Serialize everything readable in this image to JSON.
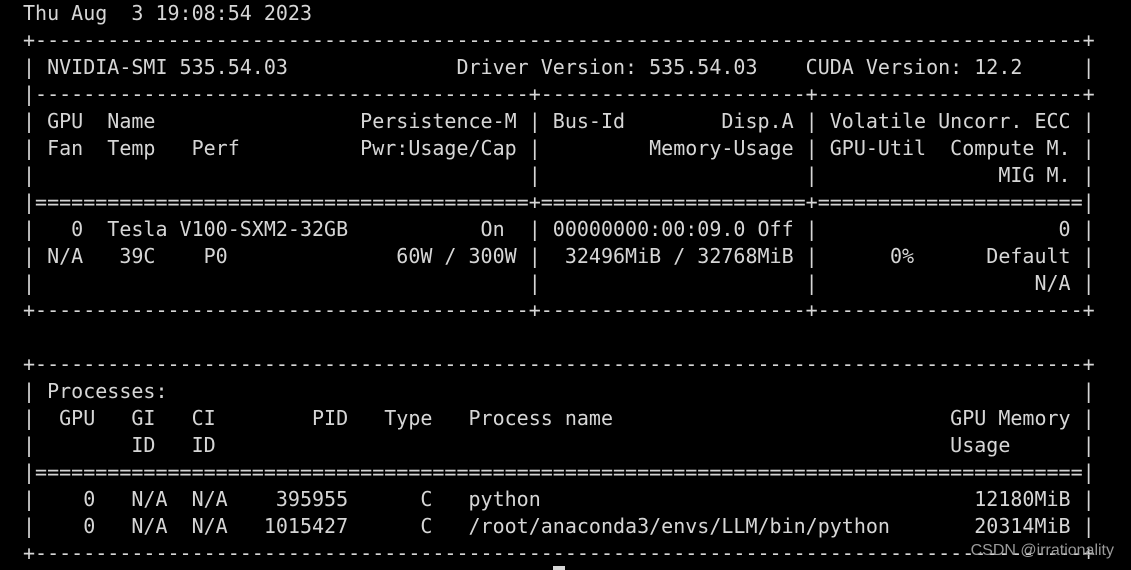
{
  "terminal": {
    "lines": [
      "Thu Aug  3 19:08:54 2023",
      "+---------------------------------------------------------------------------------------+",
      "| NVIDIA-SMI 535.54.03              Driver Version: 535.54.03    CUDA Version: 12.2     |",
      "|-----------------------------------------+----------------------+----------------------+",
      "| GPU  Name                 Persistence-M | Bus-Id        Disp.A | Volatile Uncorr. ECC |",
      "| Fan  Temp   Perf          Pwr:Usage/Cap |         Memory-Usage | GPU-Util  Compute M. |",
      "|                                         |                      |               MIG M. |",
      "|=========================================+======================+======================|",
      "|   0  Tesla V100-SXM2-32GB           On  | 00000000:00:09.0 Off |                    0 |",
      "| N/A   39C    P0              60W / 300W |  32496MiB / 32768MiB |      0%      Default |",
      "|                                         |                      |                  N/A |",
      "+-----------------------------------------+----------------------+----------------------+",
      "",
      "+---------------------------------------------------------------------------------------+",
      "| Processes:                                                                            |",
      "|  GPU   GI   CI        PID   Type   Process name                            GPU Memory |",
      "|        ID   ID                                                             Usage      |",
      "|=======================================================================================|",
      "|    0   N/A  N/A    395955      C   python                                    12180MiB |",
      "|    0   N/A  N/A   1015427      C   /root/anaconda3/envs/LLM/bin/python       20314MiB |",
      "+---------------------------------------------------------------------------------------+"
    ]
  },
  "watermark": "CSDN @irrationality",
  "colors": {
    "background": "#000000",
    "text": "#d6d6d6"
  }
}
